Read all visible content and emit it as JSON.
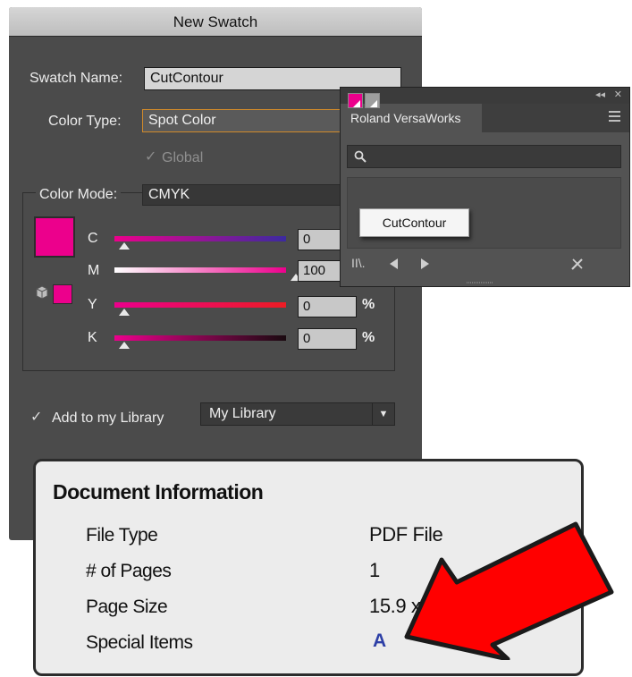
{
  "swatch_dialog": {
    "title": "New Swatch",
    "swatch_name_label": "Swatch Name:",
    "swatch_name_value": "CutContour",
    "color_type_label": "Color Type:",
    "color_type_value": "Spot Color",
    "global_label": "Global",
    "global_checked": true,
    "color_mode_label": "Color Mode:",
    "color_mode_value": "CMYK",
    "swatch_color": "#ec008c",
    "channels": [
      {
        "label": "C",
        "value": "0",
        "level": 0
      },
      {
        "label": "M",
        "value": "100",
        "level": 100
      },
      {
        "label": "Y",
        "value": "0",
        "level": 0
      },
      {
        "label": "K",
        "value": "0",
        "level": 0
      }
    ],
    "percent_sign": "%",
    "add_to_library_label": "Add to my Library",
    "add_to_library_checked": true,
    "library_value": "My Library"
  },
  "versaworks_panel": {
    "collapse_icon": "double-chevron-icon",
    "close_icon": "close-icon",
    "tab_label": "Roland VersaWorks",
    "menu_icon": "hamburger-icon",
    "search_icon": "search-icon",
    "tooltip": "CutContour",
    "chip_colors": [
      "#ec008c",
      "#9e9e9e"
    ],
    "footer_icons": [
      "library-icon",
      "previous-icon",
      "next-icon",
      "tools-icon"
    ]
  },
  "document_info": {
    "title": "Document Information",
    "rows": [
      {
        "label": "File Type",
        "value": "PDF File"
      },
      {
        "label": "# of Pages",
        "value": "1"
      },
      {
        "label": "Page Size",
        "value": "15.9 x"
      },
      {
        "label": "Special Items",
        "value": "A"
      }
    ],
    "arrow_color": "#ff0000"
  }
}
